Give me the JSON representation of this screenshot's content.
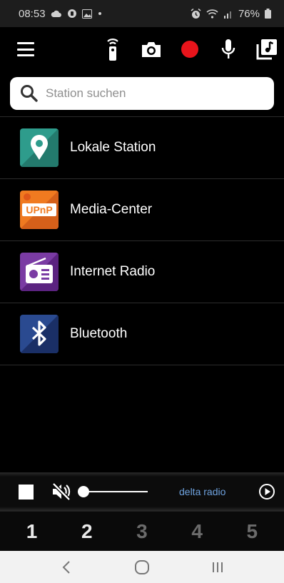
{
  "status_bar": {
    "time": "08:53",
    "battery": "76%",
    "left_icons": [
      "cloud-icon",
      "notification-icon",
      "image-icon",
      "dot-icon"
    ],
    "right_icons": [
      "alarm-icon",
      "wifi-icon",
      "signal-icon",
      "battery-icon"
    ]
  },
  "toolbar": {
    "actions": [
      "remote-control-icon",
      "camera-icon",
      "record-icon",
      "microphone-icon",
      "music-library-icon"
    ],
    "record_color": "#e8141b"
  },
  "search": {
    "placeholder": "Station suchen"
  },
  "sources": [
    {
      "label": "Lokale Station",
      "icon": "location-pin-icon",
      "color": "#2e9c8c"
    },
    {
      "label": "Media-Center",
      "icon": "upnp-icon",
      "icon_text": "UPnP",
      "color": "#f07a20"
    },
    {
      "label": "Internet Radio",
      "icon": "radio-icon",
      "color": "#6a2d91"
    },
    {
      "label": "Bluetooth",
      "icon": "bluetooth-icon",
      "color": "#1e3a78"
    }
  ],
  "player": {
    "station": "delta radio",
    "volume": 0,
    "muted": true
  },
  "presets": [
    {
      "label": "1",
      "active": true
    },
    {
      "label": "2",
      "active": true
    },
    {
      "label": "3",
      "active": false
    },
    {
      "label": "4",
      "active": false
    },
    {
      "label": "5",
      "active": false
    }
  ],
  "nav": [
    "back-icon",
    "home-icon",
    "recents-icon"
  ]
}
